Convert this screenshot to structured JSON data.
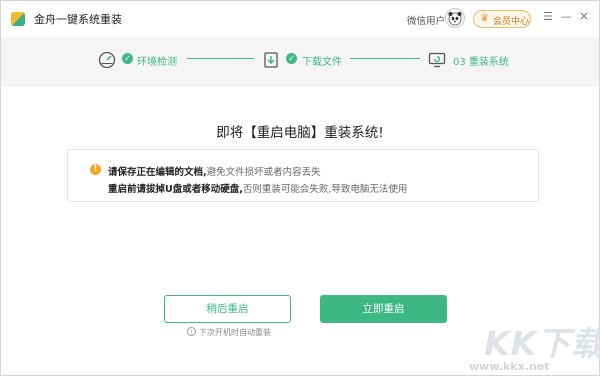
{
  "app": {
    "title": "金舟一键系统重装"
  },
  "header": {
    "user_name": "微信用户",
    "vip_label": "会员中心",
    "menu_icon": "hamburger-icon",
    "minimize_icon": "minimize-icon",
    "close_icon": "close-icon"
  },
  "steps": [
    {
      "label": "环境检测",
      "icon": "gauge-icon",
      "status": "done"
    },
    {
      "label": "下载文件",
      "icon": "download-icon",
      "status": "done"
    },
    {
      "label": "03 重装系统",
      "icon": "monitor-icon",
      "status": "current"
    }
  ],
  "main": {
    "heading": "即将【重启电脑】重装系统!",
    "notice": {
      "line1_bold": "请保存正在编辑的文档,",
      "line1_rest": "避免文件损坏或者内容丢失",
      "line2_bold": "重启前请拔掉U盘或者移动硬盘,",
      "line2_rest": "否则重装可能会失败,导致电脑无法使用"
    },
    "later_button": "稍后重启",
    "now_button": "立即重启",
    "hint": "下次开机时自动重装"
  },
  "watermark": {
    "text": "KK下载",
    "url": "www.kkx.net"
  },
  "colors": {
    "accent": "#3cb887",
    "warning": "#f5a623",
    "vip": "#d9973a"
  }
}
